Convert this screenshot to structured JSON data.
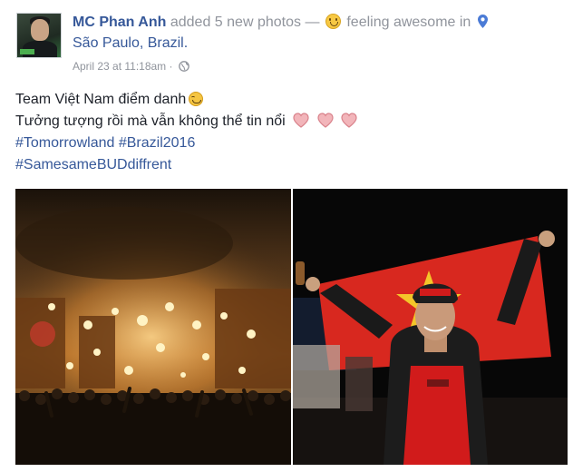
{
  "post": {
    "author": "MC Phan Anh",
    "action": "added 5 new photos",
    "separator": "—",
    "feeling": "feeling awesome in",
    "location": "São Paulo, Brazil.",
    "timestamp": "April 23 at 11:18am",
    "dot": "·",
    "icons": [
      "smiley-icon",
      "location-pin-icon",
      "globe-icon"
    ]
  },
  "content": {
    "line1": "Team Việt Nam điểm danh",
    "line2": "Tưởng tượng rồi mà vẫn không thể tin nổi",
    "hashtag1": "#Tomorrowland",
    "hashtag2": "#Brazil2016",
    "hashtag3": "#SamesameBUDdiffrent",
    "emoji_line1": "smile-icon",
    "emoji_line2": [
      "heart-icon",
      "heart-icon",
      "heart-icon"
    ],
    "heart_color": "#e9a0a6"
  },
  "colors": {
    "link": "#365899",
    "muted": "#90949c",
    "text": "#1d2129"
  }
}
